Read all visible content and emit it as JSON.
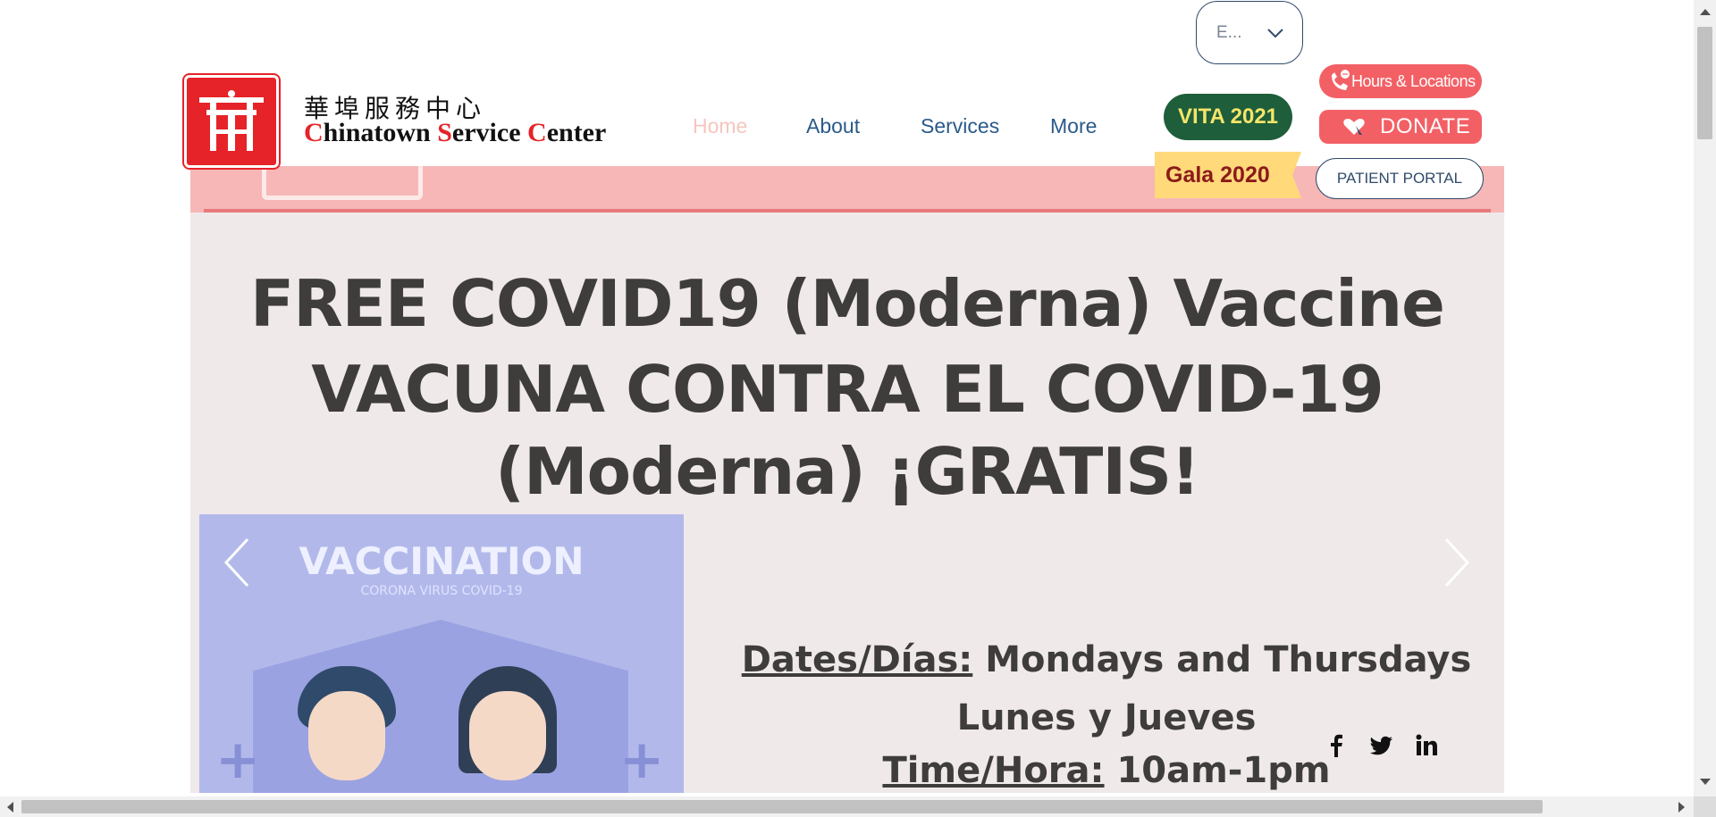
{
  "header": {
    "brand_chinese": "華埠服務中心",
    "brand_english_parts": [
      {
        "text": "C",
        "red": true
      },
      {
        "text": "hinatown ",
        "red": false
      },
      {
        "text": "S",
        "red": true
      },
      {
        "text": "ervice ",
        "red": false
      },
      {
        "text": "C",
        "red": true
      },
      {
        "text": "enter",
        "red": false
      }
    ],
    "logo_icon": "chinatown-gate-logo"
  },
  "language_selector": {
    "value": "E...",
    "icon": "chevron-down-icon"
  },
  "nav": {
    "home": "Home",
    "about": "About",
    "services": "Services",
    "more": "More"
  },
  "buttons": {
    "vita": "VITA 2021",
    "gala": "Gala 2020",
    "hours_locations": "Hours & Locations",
    "donate": "DONATE",
    "patient_portal": "PATIENT PORTAL"
  },
  "slide": {
    "title_line1": "FREE COVID19 (Moderna) Vaccine",
    "title_line2": "VACUNA CONTRA EL COVID-19",
    "title_line3": "(Moderna)  ¡GRATIS!",
    "vaccination_heading": "VACCINATION",
    "vaccination_subheading": "CORONA VIRUS COVID-19",
    "dates_label": "Dates/Días:",
    "dates_value": " Mondays and Thursdays",
    "dates_spanish": "Lunes y Jueves",
    "time_label": "Time/Hora:",
    "time_value": " 10am-1pm"
  },
  "social": [
    "facebook-icon",
    "twitter-icon",
    "linkedin-icon"
  ],
  "colors": {
    "brand_red": "#e52328",
    "nav_blue": "#2a5a8a",
    "vita_green": "#1e5e3a",
    "vita_text": "#f6e46a",
    "gala_yellow": "#ffd97a",
    "pink_button": "#f26065",
    "hero_bg": "#efe9ea"
  }
}
